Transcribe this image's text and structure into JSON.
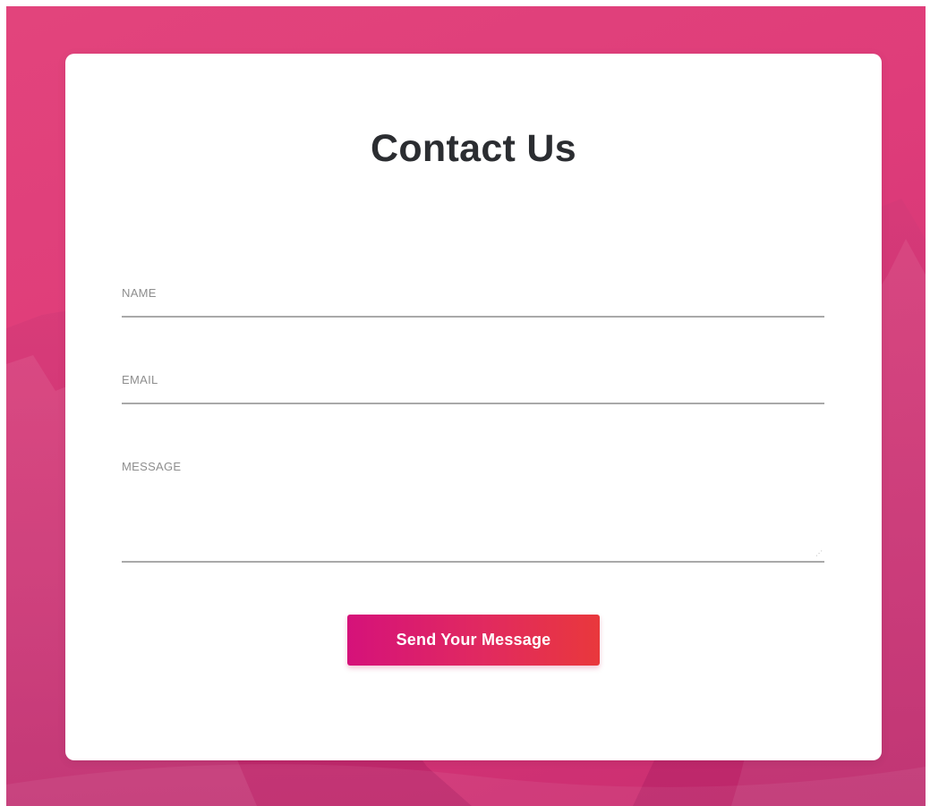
{
  "page": {
    "title": "Contact Us"
  },
  "form": {
    "fields": [
      {
        "id": "name",
        "label": "NAME",
        "value": ""
      },
      {
        "id": "email",
        "label": "EMAIL",
        "value": ""
      },
      {
        "id": "message",
        "label": "MESSAGE",
        "value": ""
      }
    ],
    "submit_label": "Send Your Message"
  },
  "colors": {
    "background_gradient": [
      "#e2447c",
      "#c92d70"
    ],
    "button_gradient": [
      "#d5127a",
      "#e9383c"
    ],
    "title_text": "#2b2d31",
    "label_text": "#8e8e8e",
    "underline": "#a9a9a9"
  },
  "icons": {
    "resize_grip": "resize-grip-icon",
    "background": "mountain-background-image"
  }
}
